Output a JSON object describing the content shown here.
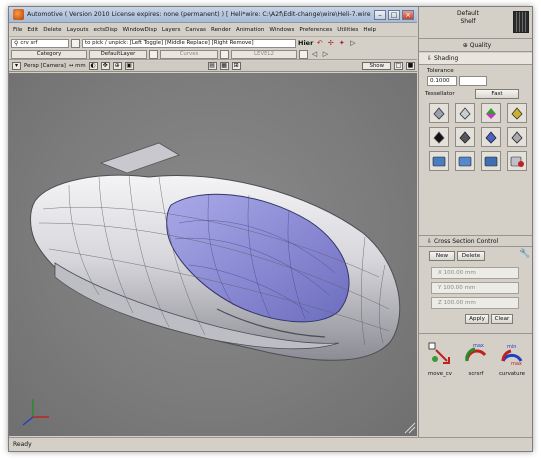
{
  "window": {
    "title": "Automotive ( Version 2010  License expires: none (permanent) ) [ Heli*wire: C:\\A2f\\Edit-change\\wire\\Heli-7.wire",
    "controls": [
      "–",
      "□",
      "×"
    ]
  },
  "menubar": {
    "items": [
      "File",
      "Edit",
      "Delete",
      "Layouts",
      "ectsDisp",
      "WindowDisp",
      "Layers",
      "Canvas",
      "Render",
      "Animation",
      "Windows",
      "Preferences",
      "Utilities",
      "Help"
    ]
  },
  "toolbar": {
    "search_value": "crv srf",
    "category_label": "Category",
    "hint_text": "to pick / unpick: [Left Toggle] [Middle Replace] [Right Remove]",
    "layer_label": "DefaultLayer",
    "curves_label": "Curves",
    "level_label": "LEVEL2",
    "toolbar_mode": "Hier"
  },
  "viewbar": {
    "view_name": "Persp [Camera]",
    "zoom": "↔ mm",
    "show_label": "Show"
  },
  "shelf": {
    "name": "Default",
    "subname": "Shelf"
  },
  "panel": {
    "quality_label": "Quality",
    "shading_label": "Shading",
    "tolerance_label": "Tolerance",
    "tolerance_value": "0.1000",
    "tessellator_label": "Tessellator",
    "tessellator_value": "Fast",
    "cross_section": {
      "title": "Cross Section Control",
      "new_label": "New",
      "delete_label": "Delete",
      "rows": [
        "X 100.00 mm",
        "Y 100.00 mm",
        "Z 100.00 mm"
      ],
      "apply_label": "Apply",
      "clear_label": "Clear"
    },
    "tools": [
      {
        "label": "move_cv",
        "icon": "move-cv-icon"
      },
      {
        "label": "scrsrf",
        "icon": "scale-surface-icon",
        "max_label": "max",
        "min_label": "min"
      },
      {
        "label": "curvature",
        "icon": "curvature-gauge-icon",
        "max_label": "max",
        "min_label": "min"
      }
    ]
  },
  "status": {
    "text": "Ready"
  },
  "colors": {
    "viewport_bg": "#7c7c7c",
    "canopy": "#8f8fd6",
    "hull": "#d8d8dc",
    "accent_red": "#b0201c"
  }
}
